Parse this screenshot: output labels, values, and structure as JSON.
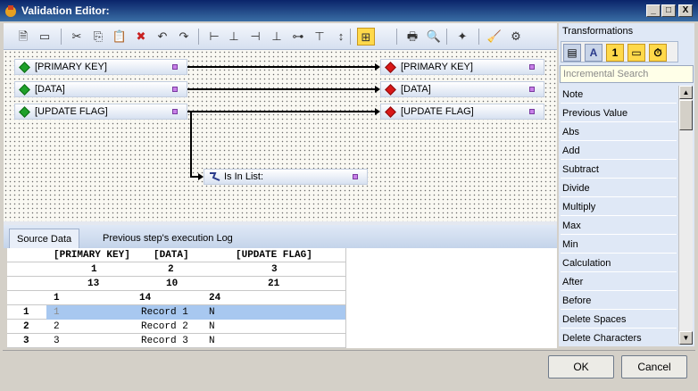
{
  "window": {
    "title": "Validation Editor:",
    "min_label": "_",
    "max_label": "□",
    "close_label": "X"
  },
  "toolbar": {
    "icons": [
      "properties-icon",
      "add-icon",
      "cut-icon",
      "copy-icon",
      "paste-icon",
      "delete-icon",
      "undo-icon",
      "redo-icon",
      "align-left-icon",
      "align-center-icon",
      "align-right-icon",
      "align-bottom-icon",
      "align-middle-icon",
      "align-top-icon",
      "same-height-icon",
      "fit-icon",
      "print-icon",
      "print-preview-icon",
      "add-item-icon",
      "clear-icon",
      "auto-layout-icon"
    ],
    "glyphs": [
      "🗎",
      "▭",
      "✂",
      "⎘",
      "📋",
      "✖",
      "↶",
      "↷",
      "⊢",
      "⊥",
      "⊣",
      "⊥",
      "⊶",
      "⊤",
      "↕",
      "⊞",
      "🖶",
      "🔍",
      "✦",
      "🧹",
      "⚙"
    ]
  },
  "canvas": {
    "source_nodes": [
      "[PRIMARY KEY]",
      "[DATA]",
      "[UPDATE FLAG]"
    ],
    "target_nodes": [
      "[PRIMARY KEY]",
      "[DATA]",
      "[UPDATE FLAG]"
    ],
    "rule_node": "Is In List:"
  },
  "tabs": [
    {
      "label": "Source Data",
      "active": true
    },
    {
      "label": "Previous step's execution Log",
      "active": false
    }
  ],
  "grid": {
    "header_fields": [
      "[PRIMARY KEY]",
      "[DATA]",
      "[UPDATE FLAG]"
    ],
    "widths_row": [
      "1",
      "2",
      "3"
    ],
    "lengths_row": [
      "13",
      "10",
      "21"
    ],
    "offset_row": [
      "1",
      "14",
      "24"
    ],
    "rows": [
      {
        "num": "1",
        "key": "1",
        "data": "Record 1",
        "flag": "N",
        "selected": true
      },
      {
        "num": "2",
        "key": "2",
        "data": "Record 2",
        "flag": "N",
        "selected": false
      },
      {
        "num": "3",
        "key": "3",
        "data": "Record 3",
        "flag": "N",
        "selected": false
      }
    ]
  },
  "side": {
    "header": "Transformations",
    "tools": [
      "▤",
      "A",
      "1",
      "▭",
      "⏱"
    ],
    "search_placeholder": "Incremental Search",
    "items": [
      "Note",
      "Previous Value",
      "Abs",
      "Add",
      "Subtract",
      "Divide",
      "Multiply",
      "Max",
      "Min",
      "Calculation",
      "After",
      "Before",
      "Delete Spaces",
      "Delete Characters"
    ]
  },
  "buttons": {
    "ok": "OK",
    "cancel": "Cancel"
  },
  "colors": {
    "title_bar": "#0a246a",
    "selection": "#a8c8f0",
    "source_diamond": "#1ea02a",
    "target_diamond": "#d81818"
  }
}
